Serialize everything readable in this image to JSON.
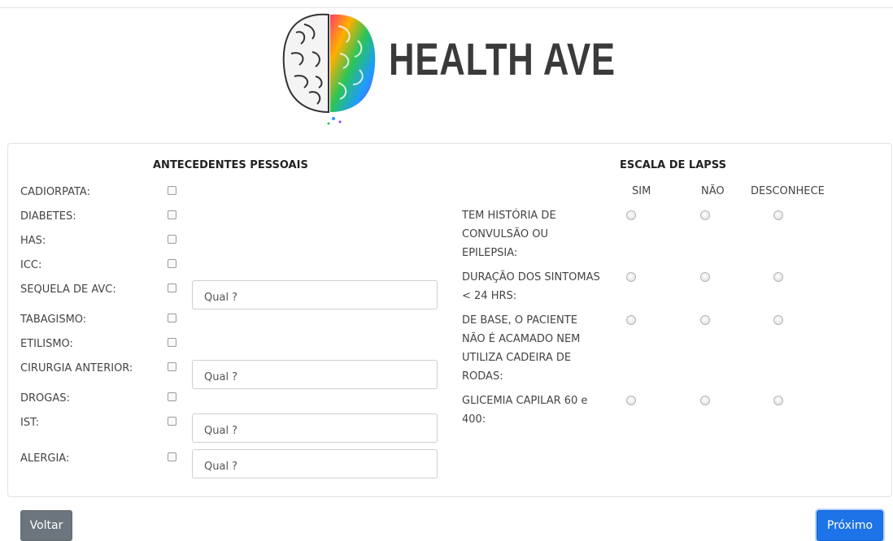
{
  "brand": {
    "name": "HEALTH AVE"
  },
  "left_section": {
    "title": "ANTECEDENTES PESSOAIS",
    "placeholder": "Qual ?",
    "items": [
      {
        "label": "CADIORPATA:"
      },
      {
        "label": "DIABETES:"
      },
      {
        "label": "HAS:"
      },
      {
        "label": "ICC:"
      },
      {
        "label": "SEQUELA DE AVC:"
      },
      {
        "label": "TABAGISMO:"
      },
      {
        "label": "ETILISMO:"
      },
      {
        "label": "CIRURGIA ANTERIOR:"
      },
      {
        "label": "DROGAS:"
      },
      {
        "label": "IST:"
      },
      {
        "label": "ALERGIA:"
      }
    ]
  },
  "right_section": {
    "title": "ESCALA DE LAPSS",
    "columns": [
      "SIM",
      "NÃO",
      "DESCONHECE"
    ],
    "questions": [
      {
        "text": "TEM HISTÓRIA DE CONVULSÃO OU EPILEPSIA:"
      },
      {
        "text": "DURAÇÃO DOS SINTOMAS < 24 HRS:"
      },
      {
        "text": "DE BASE, O PACIENTE NÃO É ACAMADO NEM UTILIZA CADEIRA DE RODAS:"
      },
      {
        "text": "GLICEMIA CAPILAR 60 e 400:"
      }
    ]
  },
  "buttons": {
    "back": "Voltar",
    "next": "Próximo"
  },
  "colors": {
    "primary": "#1d73e8",
    "secondary": "#6c757d"
  }
}
